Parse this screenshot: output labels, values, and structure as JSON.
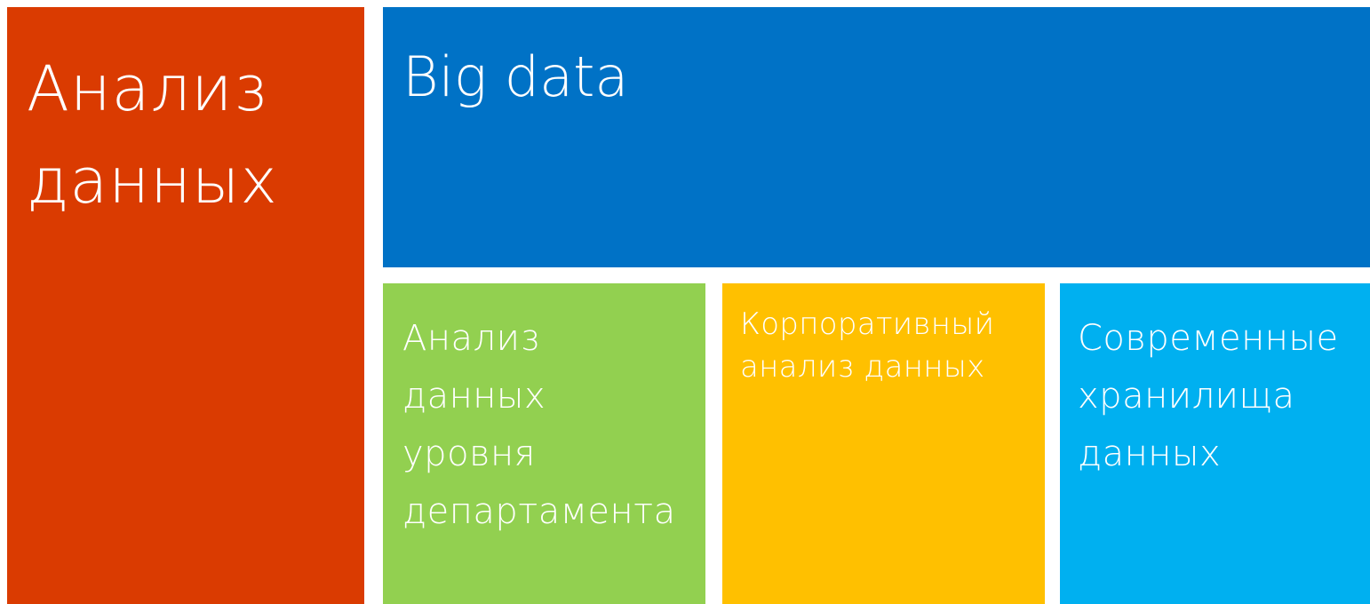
{
  "tiles": [
    {
      "id": "main",
      "label": "Анализ\nданных",
      "color": "#DA3B01"
    },
    {
      "id": "bigdata",
      "label": "Big data",
      "color": "#0072C6"
    },
    {
      "id": "dept",
      "label": "Анализ\nданных\nуровня\nдепартамента",
      "color": "#92D050"
    },
    {
      "id": "corp",
      "label": "Корпоративный\nанализ данных",
      "color": "#FFC000"
    },
    {
      "id": "modern",
      "label": "Современные\nхранилища\nданных",
      "color": "#00B0F0"
    }
  ]
}
